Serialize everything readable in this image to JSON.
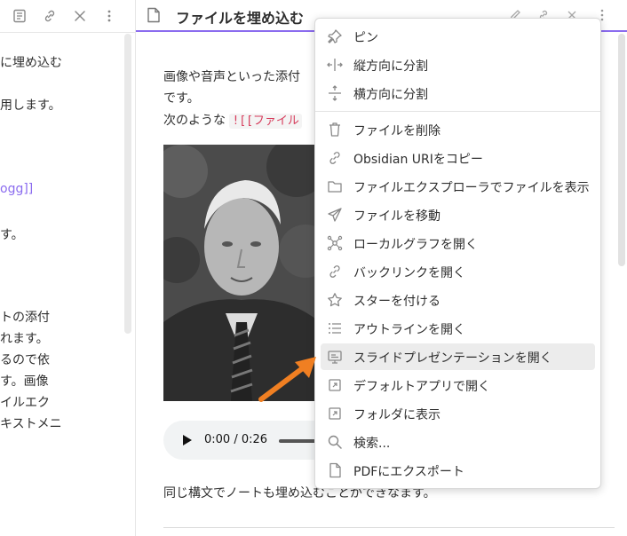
{
  "left_pane": {
    "lines": [
      "に埋め込む",
      "用します。",
      "ogg]]",
      "す。",
      "トの添付",
      "れます。",
      "るので依",
      "す。画像",
      "イルエク",
      "キストメニ"
    ]
  },
  "document": {
    "title": "ファイルを埋め込む",
    "para1_line1": "画像や音声といった添付",
    "para1_line2": "です。",
    "para2_prefix": "次のような",
    "para2_code": "![[ファイル",
    "audio_time": "0:00 / 0:26",
    "bottom_text": "同じ構文でノートも埋め込むことができなます。"
  },
  "context_menu": {
    "items": [
      {
        "label": "ピン",
        "icon": "pin-icon"
      },
      {
        "label": "縦方向に分割",
        "icon": "split-vertical-icon"
      },
      {
        "label": "横方向に分割",
        "icon": "split-horizontal-icon"
      },
      {
        "label": "ファイルを削除",
        "icon": "trash-icon"
      },
      {
        "label": "Obsidian URIをコピー",
        "icon": "link-icon"
      },
      {
        "label": "ファイルエクスプローラでファイルを表示",
        "icon": "folder-icon"
      },
      {
        "label": "ファイルを移動",
        "icon": "paper-plane-icon"
      },
      {
        "label": "ローカルグラフを開く",
        "icon": "graph-icon"
      },
      {
        "label": "バックリンクを開く",
        "icon": "backlink-icon"
      },
      {
        "label": "スターを付ける",
        "icon": "star-icon"
      },
      {
        "label": "アウトラインを開く",
        "icon": "list-icon"
      },
      {
        "label": "スライドプレゼンテーションを開く",
        "icon": "slides-icon"
      },
      {
        "label": "デフォルトアプリで開く",
        "icon": "open-external-icon"
      },
      {
        "label": "フォルダに表示",
        "icon": "open-folder-icon"
      },
      {
        "label": "検索...",
        "icon": "search-icon"
      },
      {
        "label": "PDFにエクスポート",
        "icon": "file-icon"
      }
    ],
    "highlighted_item": "スライドプレゼンテーションを開く"
  },
  "colors": {
    "accent": "#8b6cef",
    "code_text": "#d63a5a",
    "annotation_arrow": "#f07f22",
    "menu_highlight": "#ececec"
  }
}
